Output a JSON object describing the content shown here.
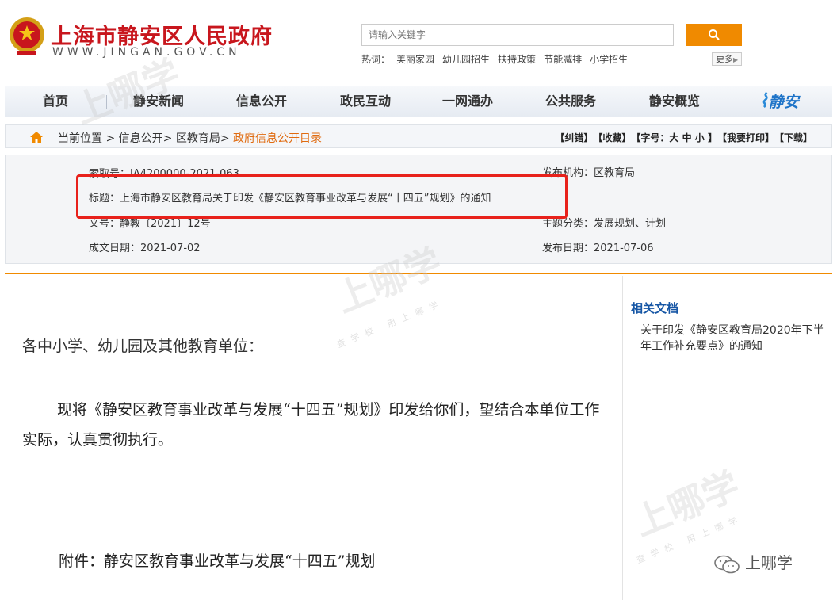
{
  "header": {
    "site_title": "上海市静安区人民政府",
    "site_url": "WWW.JINGAN.GOV.CN",
    "search_placeholder": "请输入关键字",
    "hot_label": "热词：",
    "hot_words": [
      "美丽家园",
      "幼儿园招生",
      "扶持政策",
      "节能减排",
      "小学招生"
    ],
    "more_label": "更多"
  },
  "nav": {
    "items": [
      "首页",
      "静安新闻",
      "信息公开",
      "政民互动",
      "一网通办",
      "公共服务",
      "静安概览"
    ],
    "logo_text": "静安"
  },
  "breadcrumb": {
    "prefix": "当前位置",
    "items": [
      "信息公开",
      "区教育局",
      "政府信息公开目录"
    ],
    "tools": [
      "【纠错】",
      "【收藏】",
      "【字号：大 中 小 】",
      "【我要打印】",
      "【下载】"
    ]
  },
  "meta": {
    "index_no": "索取号：IA4200000-2021-063",
    "publisher": "发布机构：区教育局",
    "title": "标题：上海市静安区教育局关于印发《静安区教育事业改革与发展“十四五”规划》的通知",
    "doc_no": "文号：静教〔2021〕12号",
    "topic": "主题分类：发展规划、计划",
    "created": "成文日期：2021-07-02",
    "published": "发布日期：2021-07-06"
  },
  "content": {
    "greeting": "各中小学、幼儿园及其他教育单位：",
    "paragraph": "现将《静安区教育事业改革与发展“十四五”规划》印发给你们，望结合本单位工作实际，认真贯彻执行。",
    "attachment": "附件：静安区教育事业改革与发展“十四五”规划"
  },
  "sidebar": {
    "related_title": "相关文档",
    "related_link": "关于印发《静安区教育局2020年下半年工作补充要点》的通知"
  },
  "watermark": {
    "brand": "上哪学",
    "sub": "查学校 用上哪学",
    "wechat_label": "上哪学"
  },
  "colors": {
    "brand_red": "#c8161d",
    "accent_orange": "#f08a00",
    "link_blue": "#1656a5",
    "highlight_red": "#e8211b"
  }
}
